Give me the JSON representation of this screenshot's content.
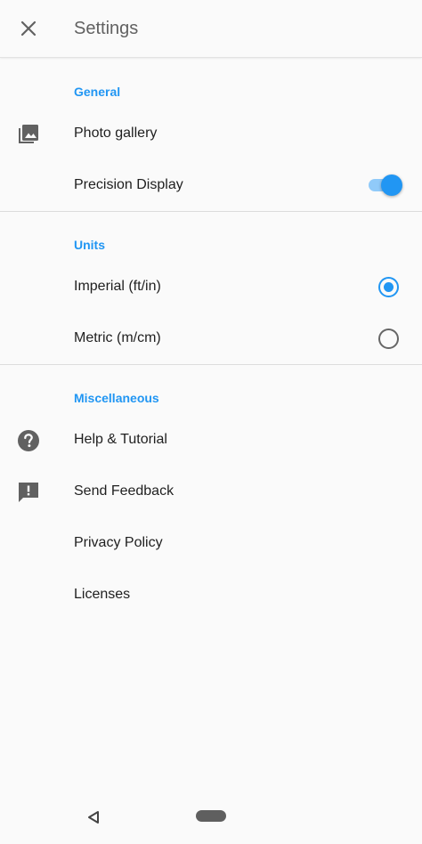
{
  "appbar": {
    "title": "Settings",
    "close_icon": "close-icon"
  },
  "sections": {
    "general": {
      "header": "General",
      "photo_gallery": {
        "label": "Photo gallery",
        "icon": "photo-library-icon"
      },
      "precision_display": {
        "label": "Precision Display",
        "enabled": true
      }
    },
    "units": {
      "header": "Units",
      "imperial": {
        "label": "Imperial (ft/in)",
        "selected": true
      },
      "metric": {
        "label": "Metric (m/cm)",
        "selected": false
      }
    },
    "misc": {
      "header": "Miscellaneous",
      "help": {
        "label": "Help & Tutorial",
        "icon": "help-icon"
      },
      "feedback": {
        "label": "Send Feedback",
        "icon": "feedback-icon"
      },
      "privacy": {
        "label": "Privacy Policy"
      },
      "licenses": {
        "label": "Licenses"
      }
    }
  },
  "colors": {
    "accent": "#2196f3",
    "accent_light": "#90caf9",
    "icon": "#616161",
    "background": "#fafafa"
  },
  "navbar": {
    "back_icon": "back-triangle-icon",
    "home_icon": "home-pill-icon"
  }
}
